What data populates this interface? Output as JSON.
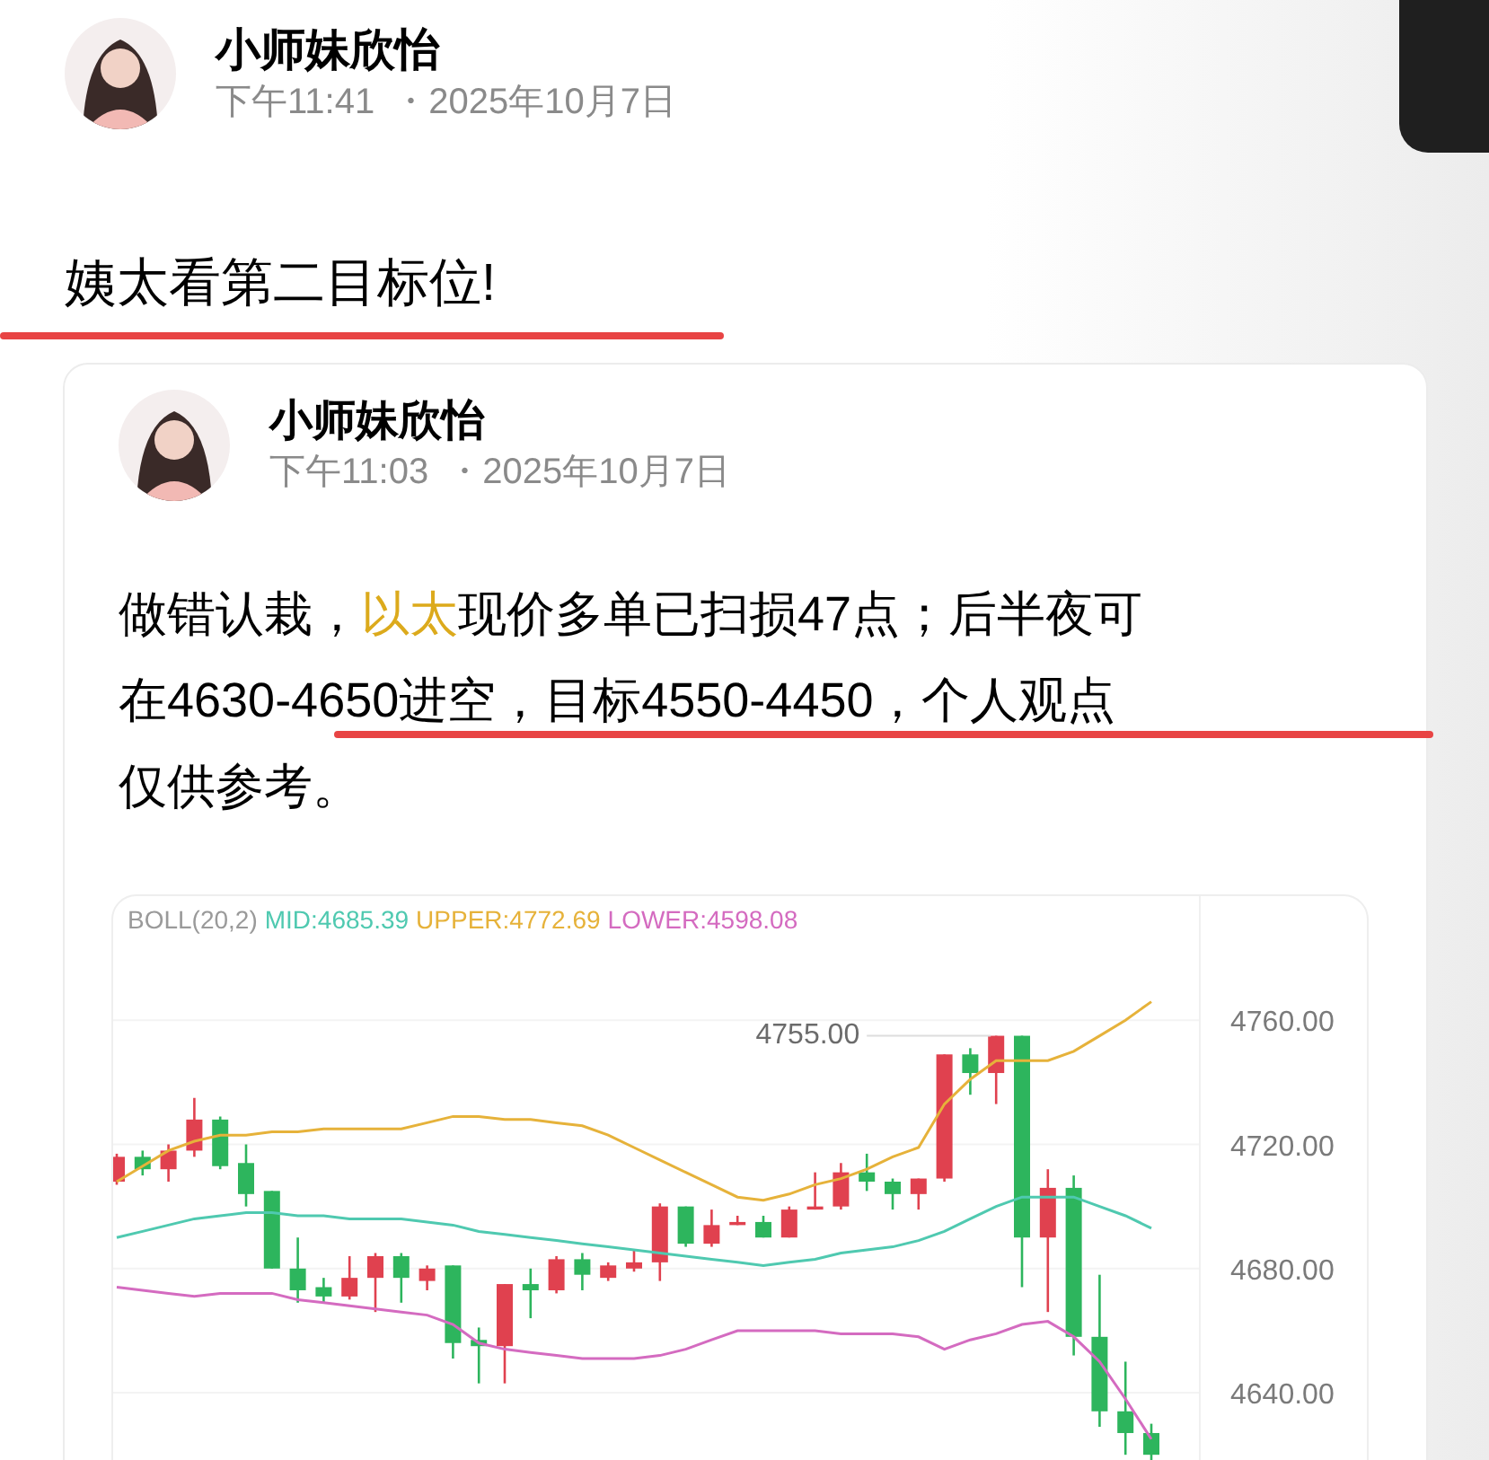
{
  "post": {
    "author": {
      "name": "小师妹欣怡"
    },
    "time": "下午11:41",
    "date": "・2025年10月7日",
    "text": "姨太看第二目标位!",
    "underlined": true
  },
  "quoted_post": {
    "author": {
      "name": "小师妹欣怡"
    },
    "time": "下午11:03",
    "date": "・2025年10月7日",
    "segments": [
      {
        "text": "做错认栽，",
        "highlighted": false
      },
      {
        "text": "以太",
        "highlighted": true
      },
      {
        "text": "现价多单已扫损47点；后半夜可在4630-4650进空，目标4550-4450，个人观点仅供参考。",
        "highlighted": false
      }
    ],
    "underlined": true,
    "chart": {
      "legend": [
        {
          "text": "BOLL(20,2)",
          "color": "#9a9a9a"
        },
        {
          "text": "MID:4685.39",
          "color": "#4fc9b0"
        },
        {
          "text": "UPPER:4772.69",
          "color": "#e6b23a"
        },
        {
          "text": "LOWER:4598.08",
          "color": "#d46bc0"
        }
      ],
      "chart_data": {
        "type": "candlestick",
        "grid": true,
        "ylim": [
          4616,
          4800
        ],
        "yticks": [
          {
            "value": 4760,
            "label": "4760.00"
          },
          {
            "value": 4720,
            "label": "4720.00"
          },
          {
            "value": 4680,
            "label": "4680.00"
          },
          {
            "value": 4640,
            "label": "4640.00"
          }
        ],
        "series": [
          {
            "type": "line",
            "color": "#e6b23a",
            "values": [
              4708,
              4713,
              4718,
              4721,
              4723,
              4723,
              4724,
              4724,
              4725,
              4725,
              4725,
              4725,
              4727,
              4729,
              4729,
              4728,
              4728,
              4727,
              4726,
              4723,
              4719,
              4715,
              4711,
              4707,
              4703,
              4702,
              4704,
              4707,
              4709,
              4712,
              4716,
              4719,
              4733,
              4741,
              4747,
              4747,
              4747,
              4750,
              4755,
              4760,
              4766
            ]
          },
          {
            "type": "line",
            "color": "#4fc9b0",
            "values": [
              4690,
              4692,
              4694,
              4696,
              4697,
              4698,
              4698,
              4697,
              4697,
              4696,
              4696,
              4696,
              4695,
              4694,
              4692,
              4691,
              4690,
              4689,
              4688,
              4687,
              4686,
              4685,
              4684,
              4683,
              4682,
              4681,
              4682,
              4683,
              4685,
              4686,
              4687,
              4689,
              4692,
              4696,
              4700,
              4703,
              4703,
              4703,
              4700,
              4697,
              4693
            ]
          },
          {
            "type": "line",
            "color": "#d46bc0",
            "values": [
              4674,
              4673,
              4672,
              4671,
              4672,
              4672,
              4672,
              4670,
              4669,
              4668,
              4667,
              4666,
              4665,
              4662,
              4656,
              4654,
              4653,
              4652,
              4651,
              4651,
              4651,
              4652,
              4654,
              4657,
              4660,
              4660,
              4660,
              4660,
              4659,
              4659,
              4659,
              4658,
              4654,
              4657,
              4659,
              4662,
              4663,
              4658,
              4650,
              4638,
              4625
            ]
          }
        ],
        "annotations": [
          "4755.00"
        ],
        "ohlc": [
          [
            4708,
            4717,
            4707,
            4716
          ],
          [
            4716,
            4718,
            4710,
            4712
          ],
          [
            4712,
            4720,
            4708,
            4718
          ],
          [
            4718,
            4735,
            4716,
            4728
          ],
          [
            4728,
            4729,
            4712,
            4713
          ],
          [
            4714,
            4720,
            4700,
            4704
          ],
          [
            4705,
            4705,
            4680,
            4680
          ],
          [
            4680,
            4690,
            4669,
            4673
          ],
          [
            4674,
            4677,
            4669,
            4671
          ],
          [
            4671,
            4684,
            4670,
            4677
          ],
          [
            4677,
            4685,
            4666,
            4684
          ],
          [
            4684,
            4685,
            4669,
            4677
          ],
          [
            4676,
            4681,
            4673,
            4680
          ],
          [
            4681,
            4681,
            4651,
            4656
          ],
          [
            4657,
            4661,
            4643,
            4655
          ],
          [
            4655,
            4675,
            4643,
            4675
          ],
          [
            4675,
            4680,
            4664,
            4673
          ],
          [
            4673,
            4684,
            4672,
            4683
          ],
          [
            4683,
            4685,
            4673,
            4678
          ],
          [
            4677,
            4682,
            4676,
            4681
          ],
          [
            4680,
            4686,
            4679,
            4682
          ],
          [
            4682,
            4701,
            4676,
            4700
          ],
          [
            4700,
            4700,
            4687,
            4688
          ],
          [
            4688,
            4699,
            4687,
            4694
          ],
          [
            4694,
            4697,
            4694,
            4695
          ],
          [
            4695,
            4697,
            4690,
            4690
          ],
          [
            4690,
            4700,
            4690,
            4699
          ],
          [
            4699,
            4711,
            4699,
            4700
          ],
          [
            4700,
            4714,
            4699,
            4711
          ],
          [
            4711,
            4717,
            4705,
            4708
          ],
          [
            4708,
            4709,
            4699,
            4704
          ],
          [
            4704,
            4709,
            4699,
            4709
          ],
          [
            4709,
            4749,
            4708,
            4749
          ],
          [
            4749,
            4751,
            4736,
            4743
          ],
          [
            4743,
            4755,
            4733,
            4755
          ],
          [
            4755,
            4755,
            4674,
            4690
          ],
          [
            4690,
            4712,
            4666,
            4706
          ],
          [
            4706,
            4710,
            4652,
            4658
          ],
          [
            4658,
            4678,
            4629,
            4634
          ],
          [
            4634,
            4650,
            4620,
            4627
          ],
          [
            4627,
            4630,
            4618,
            4620
          ]
        ]
      }
    }
  }
}
